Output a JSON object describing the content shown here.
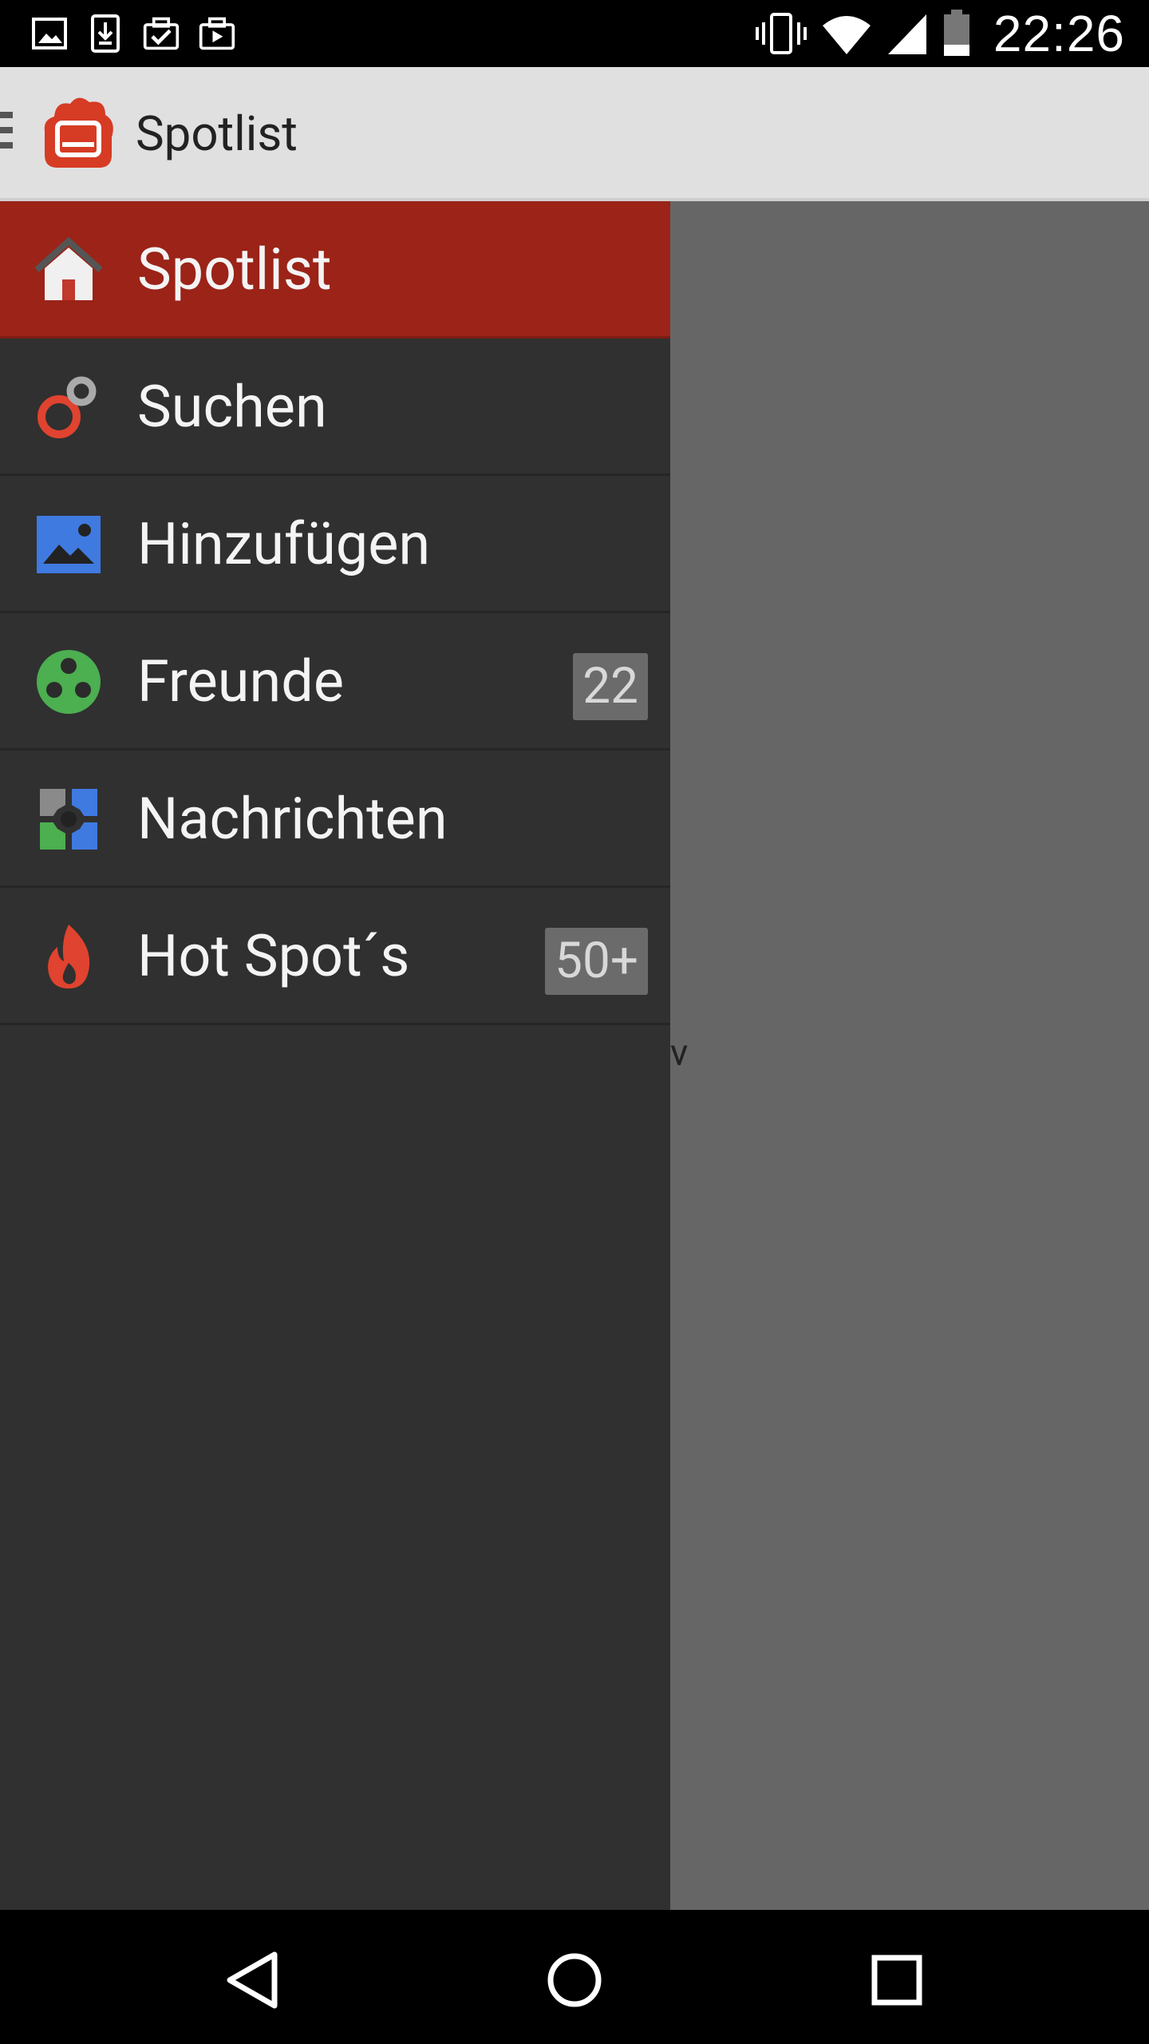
{
  "status_bar": {
    "time": "22:26",
    "left_icons": [
      "image-icon",
      "download-icon",
      "checklist-icon",
      "store-icon"
    ],
    "right_icons": [
      "vibrate-icon",
      "wifi-icon",
      "signal-icon",
      "battery-icon"
    ]
  },
  "app_bar": {
    "title": "Spotlist",
    "logo": "spotlist-logo-icon"
  },
  "drawer": {
    "items": [
      {
        "label": "Spotlist",
        "icon": "home-icon",
        "active": true
      },
      {
        "label": "Suchen",
        "icon": "search-rings-icon"
      },
      {
        "label": "Hinzufügen",
        "icon": "image-add-icon"
      },
      {
        "label": "Freunde",
        "icon": "friends-icon",
        "badge": "22"
      },
      {
        "label": "Nachrichten",
        "icon": "messages-puzzle-icon"
      },
      {
        "label": "Hot Spot´s",
        "icon": "flame-icon",
        "badge": "50+"
      }
    ]
  },
  "content": {
    "peek_text": "v"
  },
  "colors": {
    "active_item": "#9b2318",
    "drawer_bg": "#303030",
    "scrim": "#666666",
    "appbar_bg": "#e0e0e0"
  },
  "nav_bar": {
    "buttons": [
      "back-icon",
      "home-circle-icon",
      "recents-icon"
    ]
  }
}
